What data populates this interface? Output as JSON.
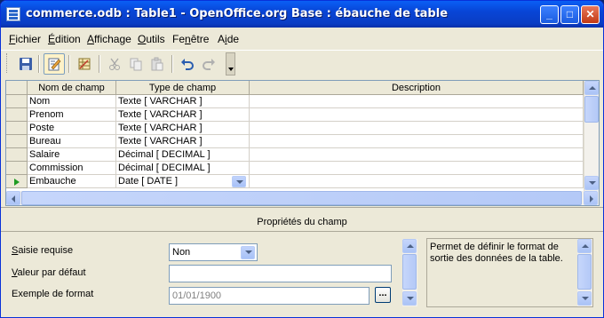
{
  "window": {
    "title": "commerce.odb : Table1 - OpenOffice.org Base : ébauche de table",
    "minimize": "_",
    "maximize": "□",
    "close": "✕"
  },
  "menu": [
    {
      "label": "Fichier",
      "accel": "F"
    },
    {
      "label": "Édition",
      "accel": "É"
    },
    {
      "label": "Affichage",
      "accel": "A"
    },
    {
      "label": "Outils",
      "accel": "O"
    },
    {
      "label": "Fenêtre",
      "accel": "n"
    },
    {
      "label": "Aide",
      "accel": "i"
    }
  ],
  "toolbar": {
    "icons": [
      "save-icon",
      "edit-icon",
      "index-design-icon",
      "cut-icon",
      "copy-icon",
      "paste-icon",
      "undo-icon",
      "redo-icon"
    ]
  },
  "table": {
    "headers": {
      "field_name": "Nom de champ",
      "field_type": "Type de champ",
      "description": "Description"
    },
    "rows": [
      {
        "name": "Nom",
        "type": "Texte [ VARCHAR ]",
        "description": ""
      },
      {
        "name": "Prenom",
        "type": "Texte [ VARCHAR ]",
        "description": ""
      },
      {
        "name": "Poste",
        "type": "Texte [ VARCHAR ]",
        "description": ""
      },
      {
        "name": "Bureau",
        "type": "Texte [ VARCHAR ]",
        "description": ""
      },
      {
        "name": "Salaire",
        "type": "Décimal [ DECIMAL ]",
        "description": ""
      },
      {
        "name": "Commission",
        "type": "Décimal [ DECIMAL ]",
        "description": ""
      },
      {
        "name": "Embauche",
        "type": "Date [ DATE ]",
        "description": "",
        "current": true
      }
    ]
  },
  "properties": {
    "title": "Propriétés du champ",
    "required_label_pre": "",
    "required_label_accel": "S",
    "required_label_post": "aisie requise",
    "required_value": "Non",
    "default_label_accel": "V",
    "default_label_post": "aleur par défaut",
    "default_value": "",
    "format_label": "Exemple de format",
    "format_value": "01/01/1900",
    "format_button": "...",
    "help_text": "Permet de définir le format de sortie des données de la table."
  }
}
